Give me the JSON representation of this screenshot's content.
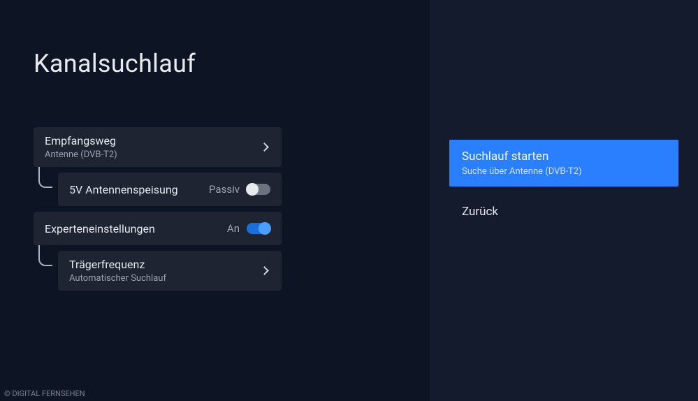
{
  "title": "Kanalsuchlauf",
  "settings": {
    "reception": {
      "label": "Empfangsweg",
      "value": "Antenne (DVB-T2)"
    },
    "antenna_power": {
      "label": "5V Antennenspeisung",
      "state_label": "Passiv",
      "enabled": false
    },
    "expert": {
      "label": "Experteneinstellungen",
      "state_label": "An",
      "enabled": true
    },
    "carrier": {
      "label": "Trägerfrequenz",
      "value": "Automatischer Suchlauf"
    }
  },
  "actions": {
    "start": {
      "label": "Suchlauf starten",
      "sub": "Suche über Antenne (DVB-T2)"
    },
    "back": {
      "label": "Zurück"
    }
  },
  "watermark": "© DIGITAL FERNSEHEN"
}
